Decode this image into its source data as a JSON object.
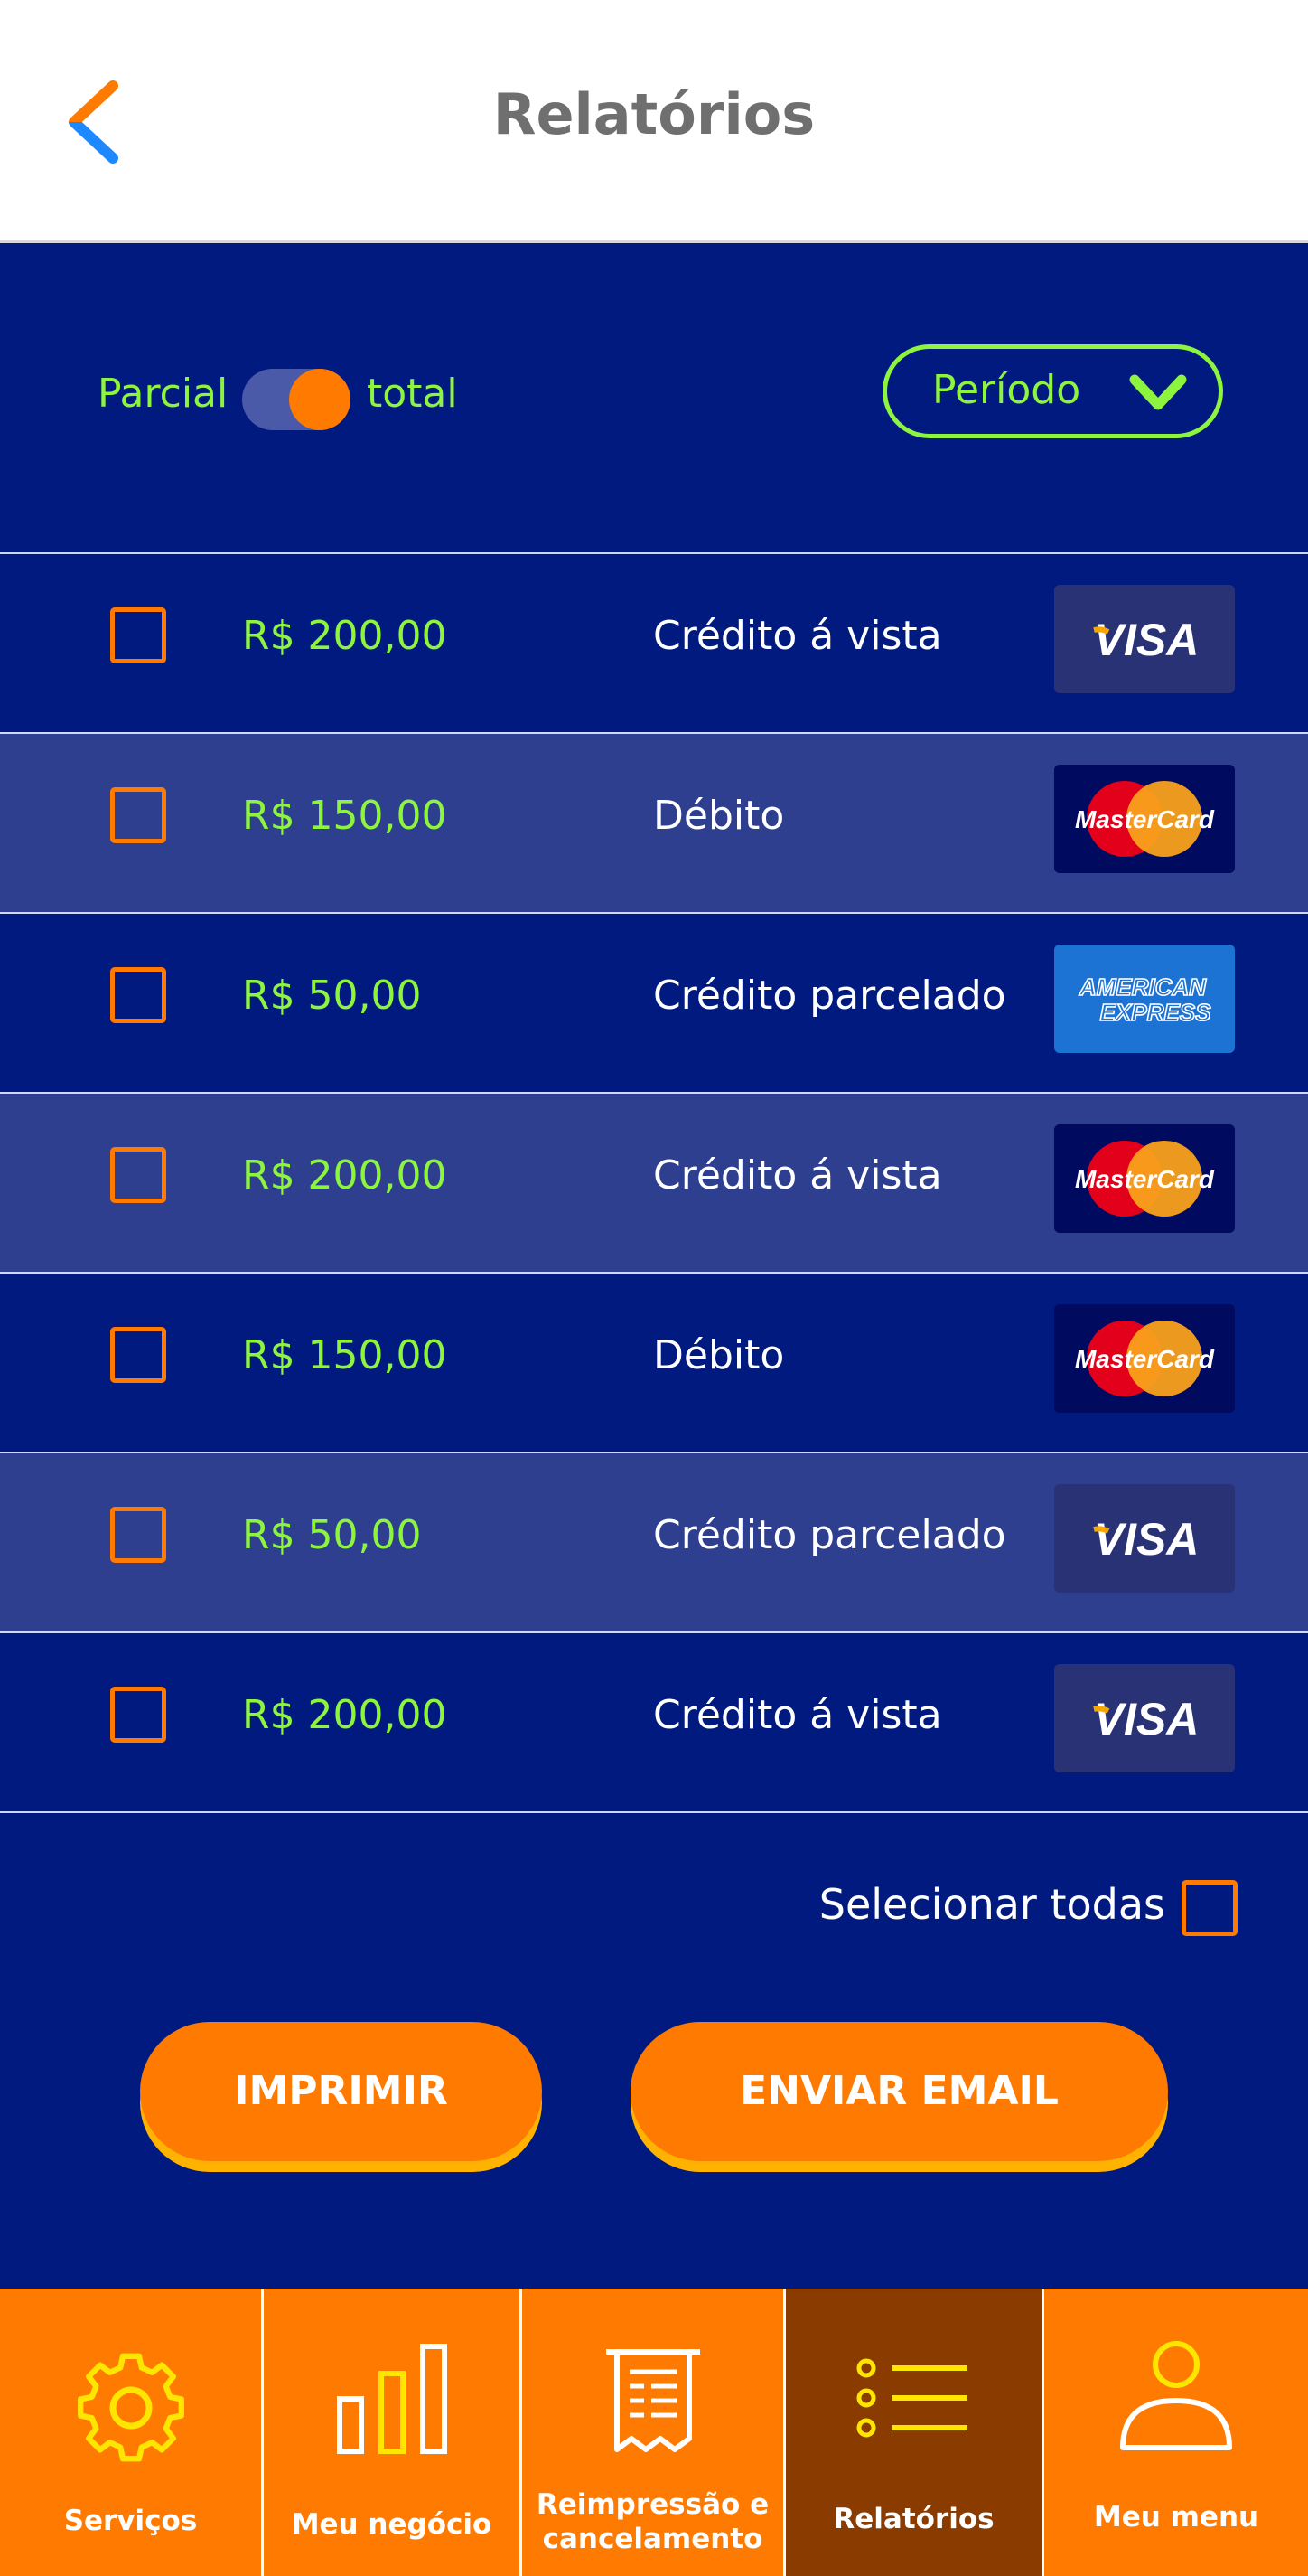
{
  "header": {
    "title": "Relatórios",
    "back_icon": "chevron-left-icon",
    "accent": "#ff7a00"
  },
  "filters": {
    "left_label": "Parcial",
    "right_label": "total",
    "toggle_on": true,
    "period_label": "Período",
    "period_icon": "chevron-down-icon"
  },
  "transactions": [
    {
      "amount": "R$ 200,00",
      "type": "Crédito á vista",
      "brand": "visa",
      "checked": false
    },
    {
      "amount": "R$ 150,00",
      "type": "Débito",
      "brand": "mastercard",
      "checked": false
    },
    {
      "amount": "R$ 50,00",
      "type": "Crédito parcelado",
      "brand": "amex",
      "checked": false
    },
    {
      "amount": "R$ 200,00",
      "type": "Crédito á vista",
      "brand": "mastercard",
      "checked": false
    },
    {
      "amount": "R$ 150,00",
      "type": "Débito",
      "brand": "mastercard",
      "checked": false
    },
    {
      "amount": "R$ 50,00",
      "type": "Crédito parcelado",
      "brand": "visa",
      "checked": false
    },
    {
      "amount": "R$ 200,00",
      "type": "Crédito á vista",
      "brand": "visa",
      "checked": false
    }
  ],
  "select_all": {
    "label": "Selecionar todas",
    "checked": false
  },
  "actions": {
    "print": "IMPRIMIR",
    "email": "ENVIAR EMAIL"
  },
  "nav": [
    {
      "label": "Serviços",
      "icon": "gear-icon",
      "active": false
    },
    {
      "label": "Meu negócio",
      "icon": "bar-chart-icon",
      "active": false
    },
    {
      "label": "Reimpressão e cancelamento",
      "icon": "receipt-icon",
      "active": false
    },
    {
      "label": "Relatórios",
      "icon": "list-icon",
      "active": true
    },
    {
      "label": "Meu menu",
      "icon": "user-icon",
      "active": false
    }
  ],
  "colors": {
    "main_bg": "#001a80",
    "row_alt_bg": "#2e3f8f",
    "amount_green": "#8ef53e",
    "orange": "#ff7a00",
    "nav_active": "#8a3c00"
  }
}
